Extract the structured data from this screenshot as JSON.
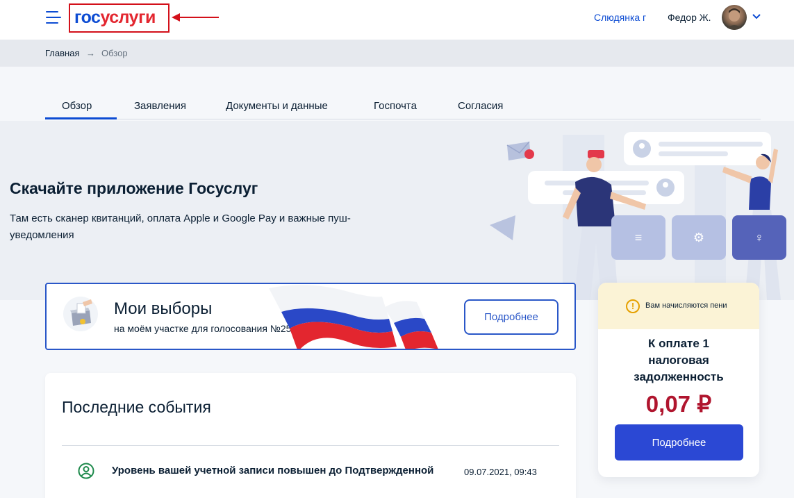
{
  "header": {
    "logo": {
      "part1": "гос",
      "part2": "услуги"
    },
    "city": "Слюдянка г",
    "user_name": "Федор Ж."
  },
  "breadcrumb": {
    "home": "Главная",
    "separator": "→",
    "current": "Обзор"
  },
  "tabs": [
    {
      "label": "Обзор",
      "active": true
    },
    {
      "label": "Заявления"
    },
    {
      "label": "Документы и данные"
    },
    {
      "label": "Госпочта"
    },
    {
      "label": "Согласия"
    }
  ],
  "banner": {
    "title": "Скачайте приложение Госуслуг",
    "text": "Там есть сканер квитанций, оплата Apple и Google Pay и важные пуш-уведомления"
  },
  "elections": {
    "title": "Мои выборы",
    "subtitle": "на моём участке для голосования №2537",
    "button": "Подробнее"
  },
  "debt": {
    "warning": "Вам начисляются пени",
    "title": "К оплате 1 налоговая задолженность",
    "amount": "0,07 ₽",
    "button": "Подробнее"
  },
  "events": {
    "title": "Последние события",
    "items": [
      {
        "text": "Уровень вашей учетной записи повышен до Подтвержденной",
        "date": "09.07.2021, 09:43"
      }
    ]
  },
  "colors": {
    "brand_blue": "#0d4cd3",
    "brand_red": "#e3262f",
    "annotation_red": "#d3101a",
    "amount_red": "#b0152e",
    "button_blue": "#2b48d4"
  }
}
